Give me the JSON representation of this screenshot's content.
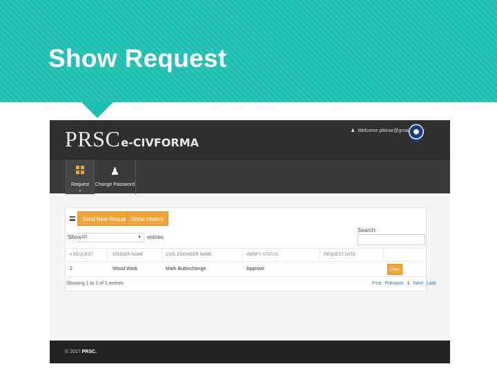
{
  "slide": {
    "title": "Show Request"
  },
  "app": {
    "logo_main": "PRSC",
    "logo_sub": "e-CIVFORMA",
    "welcome_text": "Welcome ptkinar@gmail.com",
    "welcome_caret": "▾"
  },
  "nav": {
    "items": [
      {
        "label": "Request",
        "icon": "grid-icon",
        "caret": "▾"
      },
      {
        "label": "Change Password",
        "icon": "user-icon"
      }
    ]
  },
  "content": {
    "buttons": {
      "send_new": "Send New Request",
      "show_history": "Show History"
    },
    "show_label": "Show",
    "page_size": "10",
    "entries_label": "entries",
    "search_label": "Search:",
    "table": {
      "headers": [
        "# Request",
        "Vendor Name",
        "Civil Engineer Name",
        "Verify Status",
        "Request Date",
        ""
      ],
      "rows": [
        {
          "id": "2",
          "vendor": "Wood Work",
          "engineer": "Mark Buttinchange",
          "status": "Approve",
          "date": "",
          "action": "View"
        }
      ]
    },
    "info": "Showing 1 to 1 of 1 entries",
    "pagination": [
      "First",
      "Previous",
      "1",
      "Next",
      "Last"
    ]
  },
  "footer": {
    "copyright_prefix": "© 2017",
    "copyright_brand": "PRSC."
  },
  "colors": {
    "banner": "#1cbfb1",
    "accent": "#f0a53c",
    "topbar": "#2f2f2f"
  }
}
